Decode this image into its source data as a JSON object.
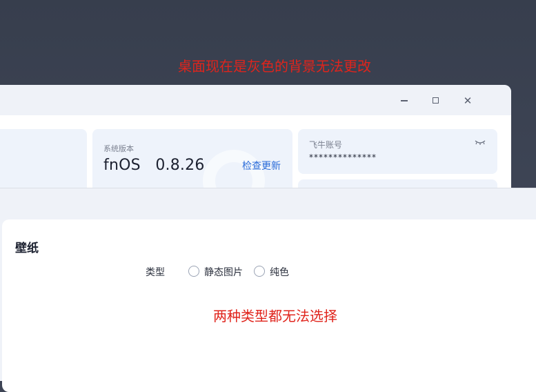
{
  "annotations": {
    "top": "桌面现在是灰色的背景无法更改",
    "middle": "两种类型都无法选择"
  },
  "window": {
    "controls": {
      "minimize_icon": "minimize-icon",
      "maximize_icon": "maximize-icon",
      "close_icon": "close-icon",
      "close_glyph": "✕"
    },
    "version_card": {
      "label": "系统版本",
      "value": "fnOS   0.8.26",
      "action": "检查更新"
    },
    "account_card": {
      "label": "飞牛账号",
      "value": "**************",
      "eye_icon": "eye-closed-icon"
    }
  },
  "settings": {
    "section_title": "壁纸",
    "type_label": "类型",
    "options": [
      {
        "label": "静态图片",
        "selected": false
      },
      {
        "label": "纯色",
        "selected": false
      }
    ]
  },
  "colors": {
    "annotation": "#e0241c",
    "link": "#2a6bd9",
    "desktop": "#3d4455"
  }
}
